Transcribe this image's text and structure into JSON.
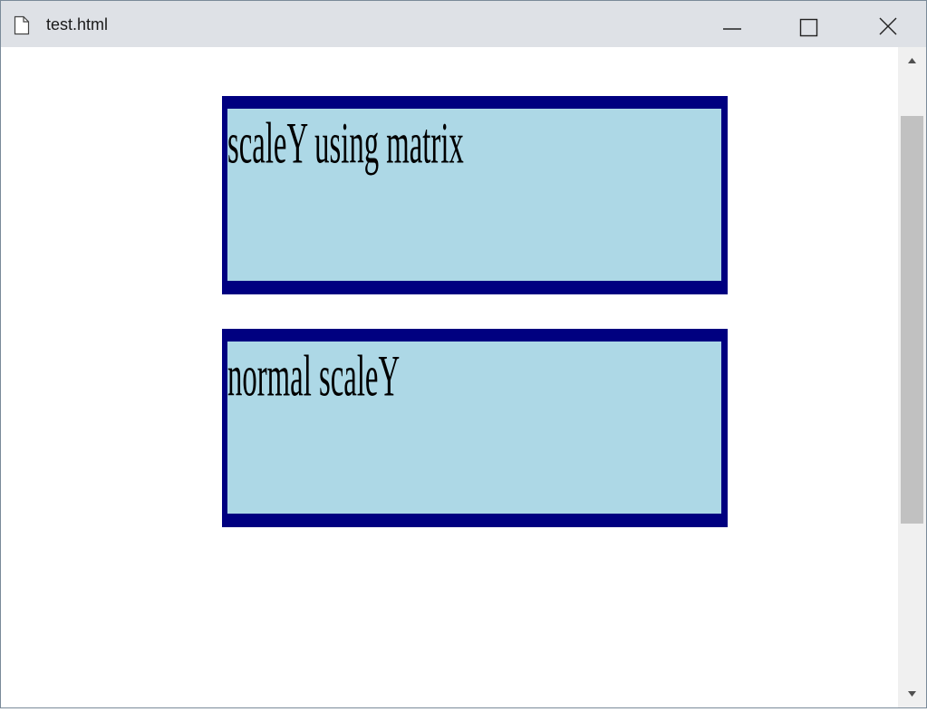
{
  "window": {
    "title": "test.html",
    "icons": {
      "page": "page-icon",
      "minimize": "minimize-icon",
      "maximize": "maximize-icon",
      "close": "close-icon"
    }
  },
  "scrollbar": {
    "up_icon": "arrow-up-icon",
    "down_icon": "arrow-down-icon"
  },
  "content": {
    "box_matrix_text": "scaleY using matrix",
    "box_normal_text": "normal scaleY"
  },
  "colors": {
    "titlebar": "#dee1e6",
    "box_background": "#add8e6",
    "box_border": "#000080",
    "scrollbar_track": "#f0f0f0",
    "scrollbar_thumb": "#c1c1c1"
  }
}
